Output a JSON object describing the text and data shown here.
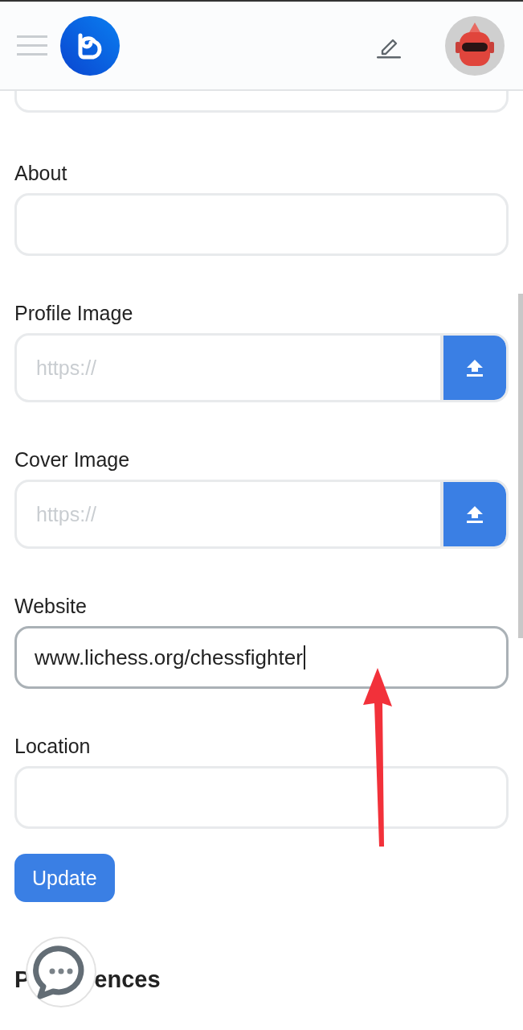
{
  "fields": [
    {
      "kind": "cut_text",
      "focused": false
    },
    {
      "kind": "text",
      "label": "About",
      "focused": false
    },
    {
      "kind": "upload",
      "label": "Profile Image",
      "placeholder": "https://",
      "focused": false
    },
    {
      "kind": "upload",
      "label": "Cover Image",
      "placeholder": "https://",
      "focused": false
    },
    {
      "kind": "text",
      "label": "Website",
      "value": "www.lichess.org/chessfighter",
      "focused": true
    },
    {
      "kind": "text",
      "label": "Location",
      "focused": false
    }
  ],
  "update_button": "Update",
  "section_heading_visible_parts": [
    "P",
    "ences"
  ]
}
